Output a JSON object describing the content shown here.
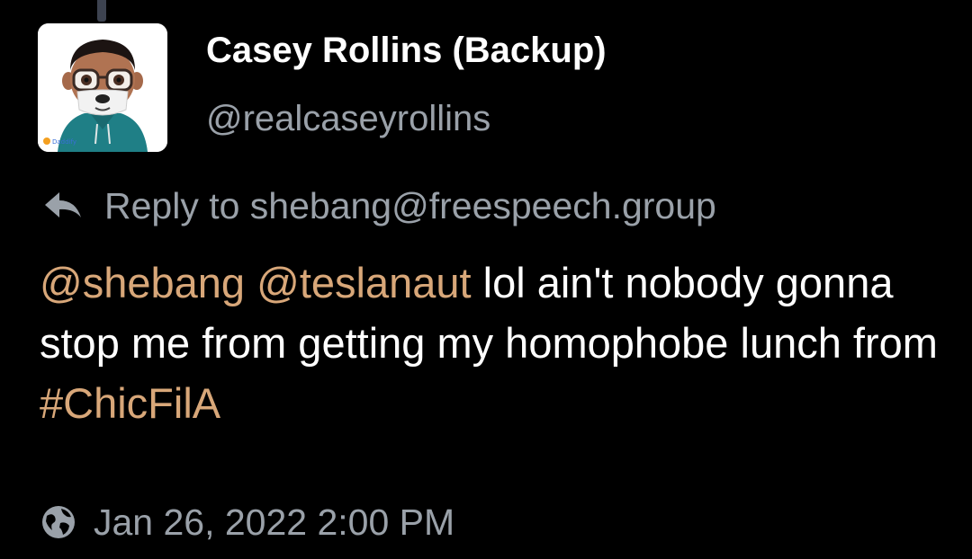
{
  "post": {
    "author": {
      "display_name": "Casey Rollins (Backup)",
      "handle": "@realcaseyrollins",
      "avatar_icon": "memoji-avatar",
      "avatar_badge_text": "Daddify"
    },
    "reply_to": {
      "icon": "reply-arrow-icon",
      "text": "Reply to shebang@freespeech.group"
    },
    "body": {
      "mention_1": "@shebang",
      "mention_2": "@teslanaut",
      "text_1": " lol ain't nobody gonna stop me from getting my homophobe lunch from ",
      "hashtag": "#ChicFilA"
    },
    "timestamp": {
      "icon": "globe-icon",
      "text": "Jan 26, 2022 2:00 PM"
    }
  },
  "colors": {
    "background": "#000000",
    "primary_text": "#ffffff",
    "secondary_text": "#9aa1a9",
    "link_accent": "#d8a779"
  }
}
